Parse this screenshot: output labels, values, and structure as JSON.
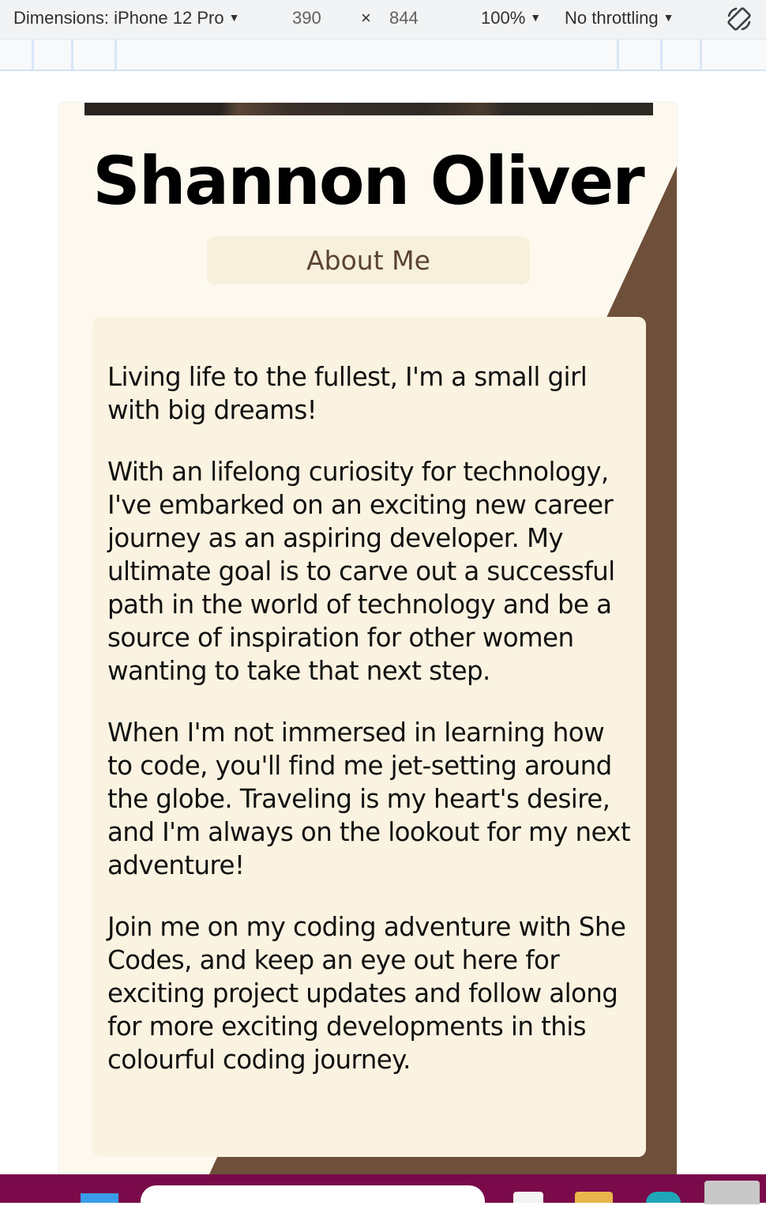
{
  "devtools": {
    "dimensions_label": "Dimensions: iPhone 12 Pro",
    "width": "390",
    "times": "×",
    "height": "844",
    "zoom": "100%",
    "throttling": "No throttling",
    "rotate_icon": "rotate-icon"
  },
  "page": {
    "name": "Shannon Oliver",
    "about_button": "About Me",
    "bio": [
      "Living life to the fullest, I'm a small girl with big dreams!",
      "With an lifelong curiosity for technology, I've embarked on an exciting new career journey as an aspiring developer. My ultimate goal is to carve out a successful path in the world of technology and be a source of inspiration for other women wanting to take that next step.",
      "When I'm not immersed in learning how to code, you'll find me jet-setting around the globe. Traveling is my heart's desire, and I'm always on the lookout for my next adventure!",
      "Join me on my coding adventure with She Codes, and keep an eye out here for exciting project updates and follow along for more exciting developments in this colourful coding journey."
    ]
  },
  "colors": {
    "page_bg": "#fdf9ee",
    "accent_brown": "#6e4f3a",
    "button_bg": "#f7f0dd",
    "bio_bg": "#faf3e1",
    "taskbar": "#7a0a4a"
  }
}
